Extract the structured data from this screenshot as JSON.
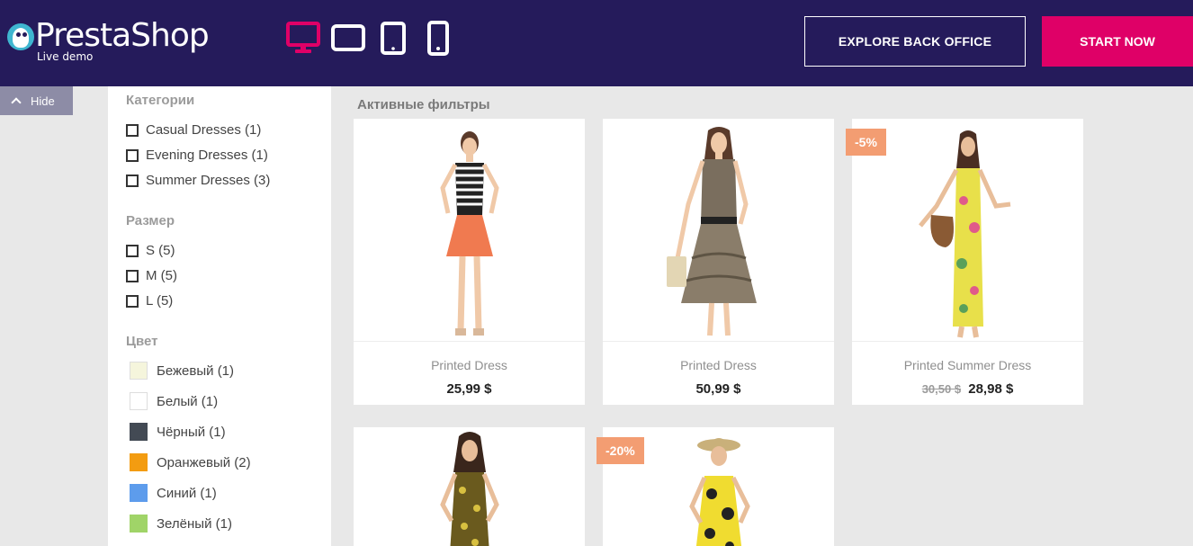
{
  "header": {
    "logo_word": "PrestaShop",
    "logo_sub": "Live demo",
    "explore_label": "EXPLORE BACK OFFICE",
    "start_label": "START NOW",
    "accent": "#df0067",
    "bg": "#251b5b",
    "devices": [
      {
        "icon": "desktop-icon",
        "active": true
      },
      {
        "icon": "tablet-landscape-icon",
        "active": false
      },
      {
        "icon": "tablet-portrait-icon",
        "active": false
      },
      {
        "icon": "mobile-icon",
        "active": false
      }
    ]
  },
  "hide_tab": {
    "label": "Hide"
  },
  "filters": {
    "categories": {
      "title": "Категории",
      "items": [
        {
          "label": "Casual Dresses (1)"
        },
        {
          "label": "Evening Dresses (1)"
        },
        {
          "label": "Summer Dresses (3)"
        }
      ]
    },
    "size": {
      "title": "Размер",
      "items": [
        {
          "label": "S (5)"
        },
        {
          "label": "M (5)"
        },
        {
          "label": "L (5)"
        }
      ]
    },
    "color": {
      "title": "Цвет",
      "items": [
        {
          "label": "Бежевый (1)",
          "color": "#f5f5dc"
        },
        {
          "label": "Белый (1)",
          "color": "#ffffff"
        },
        {
          "label": "Чёрный (1)",
          "color": "#434a54"
        },
        {
          "label": "Оранжевый (2)",
          "color": "#f39c11"
        },
        {
          "label": "Синий (1)",
          "color": "#5d9cec"
        },
        {
          "label": "Зелёный (1)",
          "color": "#a0d468"
        }
      ]
    }
  },
  "main": {
    "active_filters": "Активные фильтры",
    "products": [
      {
        "name": "Printed Dress",
        "price": "25,99 $",
        "old_price": "",
        "badge": ""
      },
      {
        "name": "Printed Dress",
        "price": "50,99 $",
        "old_price": "",
        "badge": ""
      },
      {
        "name": "Printed Summer Dress",
        "price": "28,98 $",
        "old_price": "30,50 $",
        "badge": "-5%"
      },
      {
        "name": "",
        "price": "",
        "old_price": "",
        "badge": ""
      },
      {
        "name": "",
        "price": "",
        "old_price": "",
        "badge": "-20%"
      }
    ]
  }
}
